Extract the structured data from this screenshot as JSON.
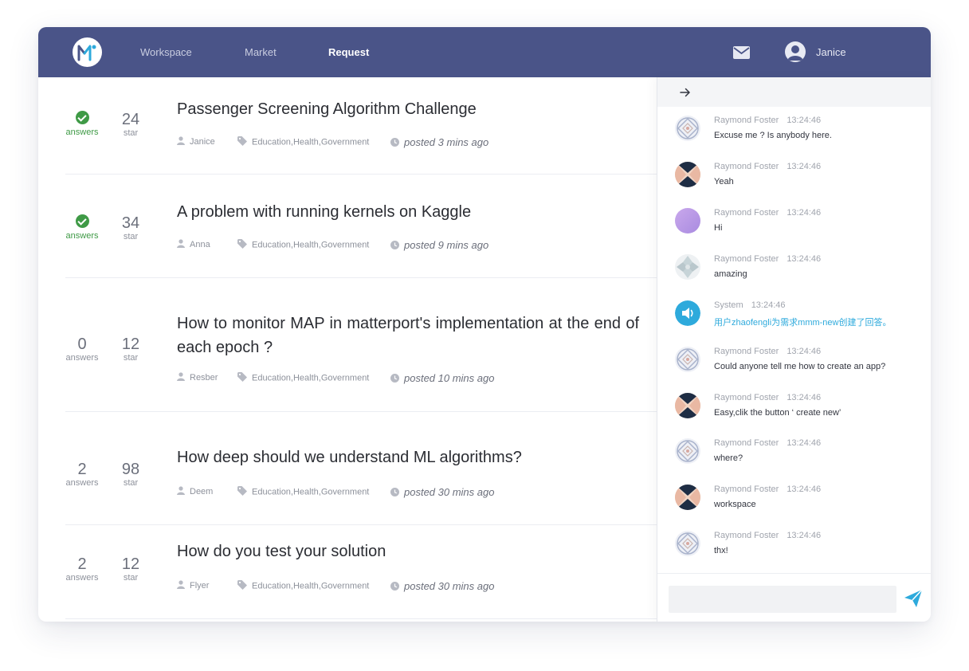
{
  "nav": {
    "links": [
      "Workspace",
      "Market",
      "Request"
    ],
    "active": "Request",
    "user_name": "Janice"
  },
  "questions": [
    {
      "answers": "",
      "answers_label": "answers",
      "answered": true,
      "stars": "24",
      "stars_label": "star",
      "title": "Passenger Screening Algorithm Challenge",
      "author": "Janice",
      "tags": "Education,Health,Government",
      "posted": "posted  3 mins ago"
    },
    {
      "answers": "",
      "answers_label": "answers",
      "answered": true,
      "stars": "34",
      "stars_label": "star",
      "title": "A problem with running kernels on Kaggle",
      "author": "Anna",
      "tags": "Education,Health,Government",
      "posted": "posted  9 mins ago"
    },
    {
      "answers": "0",
      "answers_label": "answers",
      "answered": false,
      "stars": "12",
      "stars_label": "star",
      "title": "How to monitor MAP in matterport's implementation at the end of each epoch ?",
      "author": "Resber",
      "tags": "Education,Health,Government",
      "posted": "posted  10 mins ago"
    },
    {
      "answers": "2",
      "answers_label": "answers",
      "answered": false,
      "stars": "98",
      "stars_label": "star",
      "title": "How deep should we understand ML algorithms?",
      "author": "Deem",
      "tags": "Education,Health,Government",
      "posted": "posted  30 mins ago"
    },
    {
      "answers": "2",
      "answers_label": "answers",
      "answered": false,
      "stars": "12",
      "stars_label": "star",
      "title": "How do you test your solution",
      "author": "Flyer",
      "tags": "Education,Health,Government",
      "posted": "posted  30 mins ago"
    }
  ],
  "chat": {
    "messages": [
      {
        "from": "Raymond Foster",
        "time": "13:24:46",
        "text": "Excuse me ? Is anybody here.",
        "avatar": "pattern-avatar"
      },
      {
        "from": "Raymond Foster",
        "time": "13:24:46",
        "text": "Yeah",
        "avatar": "dark-geometric-avatar"
      },
      {
        "from": "Raymond Foster",
        "time": "13:24:46",
        "text": "Hi",
        "avatar": "purple-gradient-avatar"
      },
      {
        "from": "Raymond Foster",
        "time": "13:24:46",
        "text": "amazing",
        "avatar": "mosaic-avatar"
      },
      {
        "from": "System",
        "time": "13:24:46",
        "text": "用户zhaofengli为需求mmm-new创建了回答。",
        "avatar": "speaker-icon"
      },
      {
        "from": "Raymond Foster",
        "time": "13:24:46",
        "text": "Could anyone tell me how to create an app?",
        "avatar": "pattern-avatar"
      },
      {
        "from": "Raymond Foster",
        "time": "13:24:46",
        "text": "Easy,clik the button ‘ create new’",
        "avatar": "dark-geometric-avatar"
      },
      {
        "from": "Raymond Foster",
        "time": "13:24:46",
        "text": "where?",
        "avatar": "pattern-avatar"
      },
      {
        "from": "Raymond Foster",
        "time": "13:24:46",
        "text": "workspace",
        "avatar": "dark-geometric-avatar"
      },
      {
        "from": "Raymond Foster",
        "time": "13:24:46",
        "text": "thx!",
        "avatar": "pattern-avatar"
      }
    ],
    "input_placeholder": ""
  },
  "colors": {
    "navbar": "#4a5488",
    "answered_green": "#3f9a46",
    "system_blue": "#2eaadc",
    "send_blue": "#2eaadc"
  }
}
